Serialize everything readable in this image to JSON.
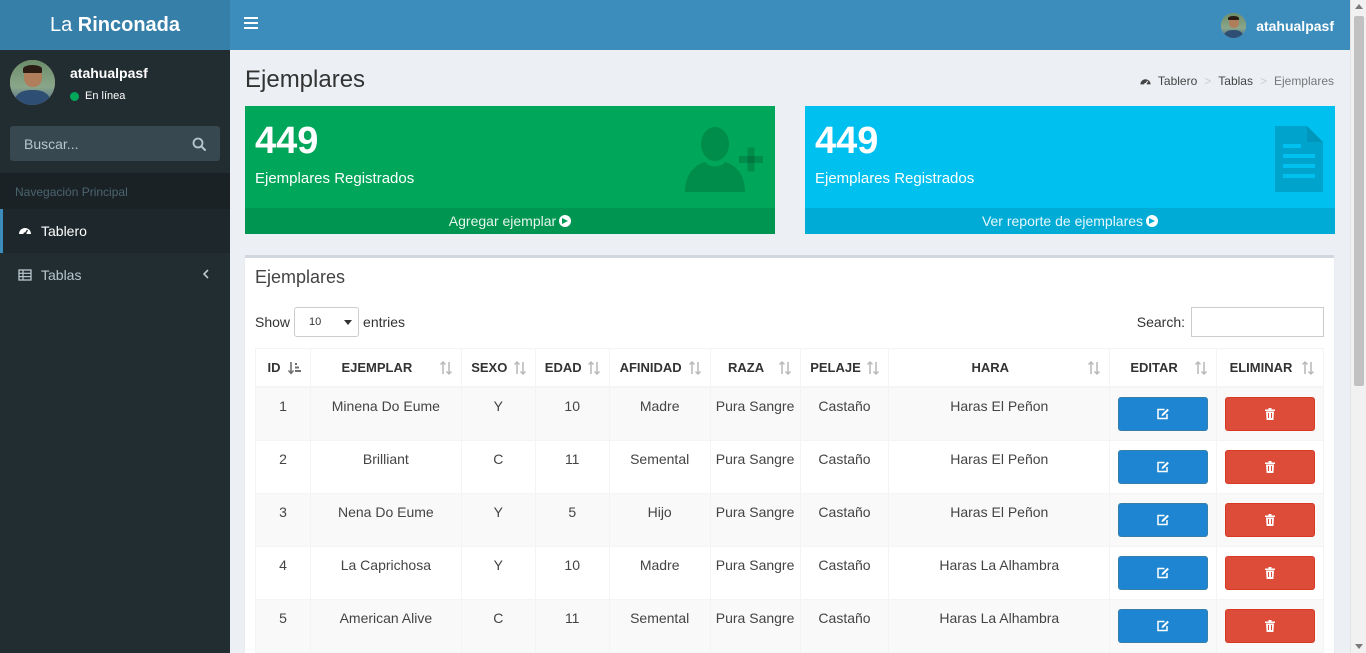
{
  "app": {
    "brand_light": "La",
    "brand_bold": "Rinconada",
    "user_name": "atahualpasf",
    "status": "En línea"
  },
  "colors": {
    "navbar": "#3c8dbc",
    "logo": "#367fa9",
    "sidebar": "#222d32",
    "green": "#00a65a",
    "aqua": "#00c0ef",
    "edit_button": "#1d85d1",
    "delete_button": "#dd4b39"
  },
  "sidebar": {
    "search_placeholder": "Buscar...",
    "header": "Navegación Principal",
    "items": [
      {
        "label": "Tablero",
        "icon": "dashboard-icon"
      },
      {
        "label": "Tablas",
        "icon": "table-icon"
      }
    ]
  },
  "page": {
    "title": "Ejemplares",
    "breadcrumb": [
      "Tablero",
      "Tablas",
      "Ejemplares"
    ]
  },
  "stats": [
    {
      "number": "449",
      "label": "Ejemplares Registrados",
      "footer": "Agregar ejemplar",
      "icon": "user-plus-icon"
    },
    {
      "number": "449",
      "label": "Ejemplares Registrados",
      "footer": "Ver reporte de ejemplares",
      "icon": "file-text-icon"
    }
  ],
  "table_box": {
    "title": "Ejemplares",
    "show_label": "Show",
    "entries_label": "entries",
    "page_length": "10",
    "search_label": "Search:",
    "search_value": "",
    "columns": [
      "ID",
      "EJEMPLAR",
      "SEXO",
      "EDAD",
      "AFINIDAD",
      "RAZA",
      "PELAJE",
      "HARA",
      "EDITAR",
      "ELIMINAR"
    ],
    "rows": [
      {
        "id": "1",
        "ejemplar": "Minena Do Eume",
        "sexo": "Y",
        "edad": "10",
        "afinidad": "Madre",
        "raza": "Pura Sangre",
        "pelaje": "Castaño",
        "hara": "Haras El Peñon"
      },
      {
        "id": "2",
        "ejemplar": "Brilliant",
        "sexo": "C",
        "edad": "11",
        "afinidad": "Semental",
        "raza": "Pura Sangre",
        "pelaje": "Castaño",
        "hara": "Haras El Peñon"
      },
      {
        "id": "3",
        "ejemplar": "Nena Do Eume",
        "sexo": "Y",
        "edad": "5",
        "afinidad": "Hijo",
        "raza": "Pura Sangre",
        "pelaje": "Castaño",
        "hara": "Haras El Peñon"
      },
      {
        "id": "4",
        "ejemplar": "La Caprichosa",
        "sexo": "Y",
        "edad": "10",
        "afinidad": "Madre",
        "raza": "Pura Sangre",
        "pelaje": "Castaño",
        "hara": "Haras La Alhambra"
      },
      {
        "id": "5",
        "ejemplar": "American Alive",
        "sexo": "C",
        "edad": "11",
        "afinidad": "Semental",
        "raza": "Pura Sangre",
        "pelaje": "Castaño",
        "hara": "Haras La Alhambra"
      }
    ]
  }
}
